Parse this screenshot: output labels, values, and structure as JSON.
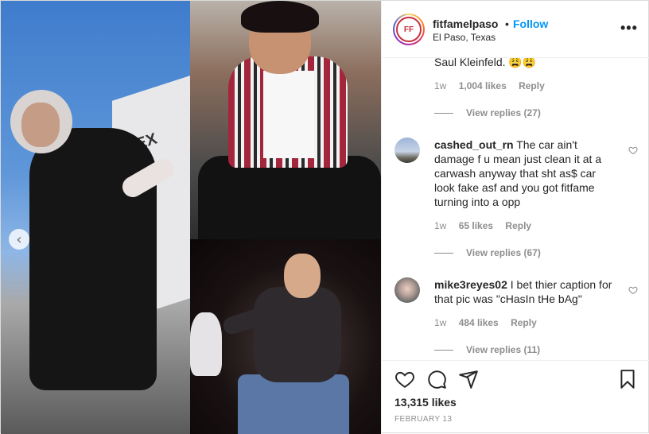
{
  "post": {
    "username": "fitfamelpaso",
    "separator": "•",
    "follow_label": "Follow",
    "location": "El Paso, Texas",
    "more_icon_label": "•••",
    "avatar_text": "FF",
    "carousel_prev_glyph": "‹",
    "truck_text": "TEX"
  },
  "comments": [
    {
      "text": "Saul Kleinfeld. 😩😩",
      "time": "1w",
      "likes": "1,004 likes",
      "reply_label": "Reply",
      "view_replies": "View replies (27)"
    },
    {
      "username": "cashed_out_rn",
      "text": "The car ain't damage f u mean just clean it at a carwash anyway that sht as$ car look fake asf and you got fitfame turning into a opp",
      "time": "1w",
      "likes": "65 likes",
      "reply_label": "Reply",
      "view_replies": "View replies (67)"
    },
    {
      "username": "mike3reyes02",
      "text": "I bet thier caption for that pic was \"cHasIn tHe bAg\"",
      "time": "1w",
      "likes": "484 likes",
      "reply_label": "Reply",
      "view_replies": "View replies (11)"
    }
  ],
  "footer": {
    "likes": "13,315 likes",
    "date": "FEBRUARY 13"
  },
  "colors": {
    "follow": "#0095f6",
    "muted": "#8e8e8e",
    "text": "#262626"
  },
  "icons": [
    "heart-icon",
    "comment-icon",
    "share-icon",
    "bookmark-icon",
    "chevron-left-icon",
    "more-icon"
  ]
}
